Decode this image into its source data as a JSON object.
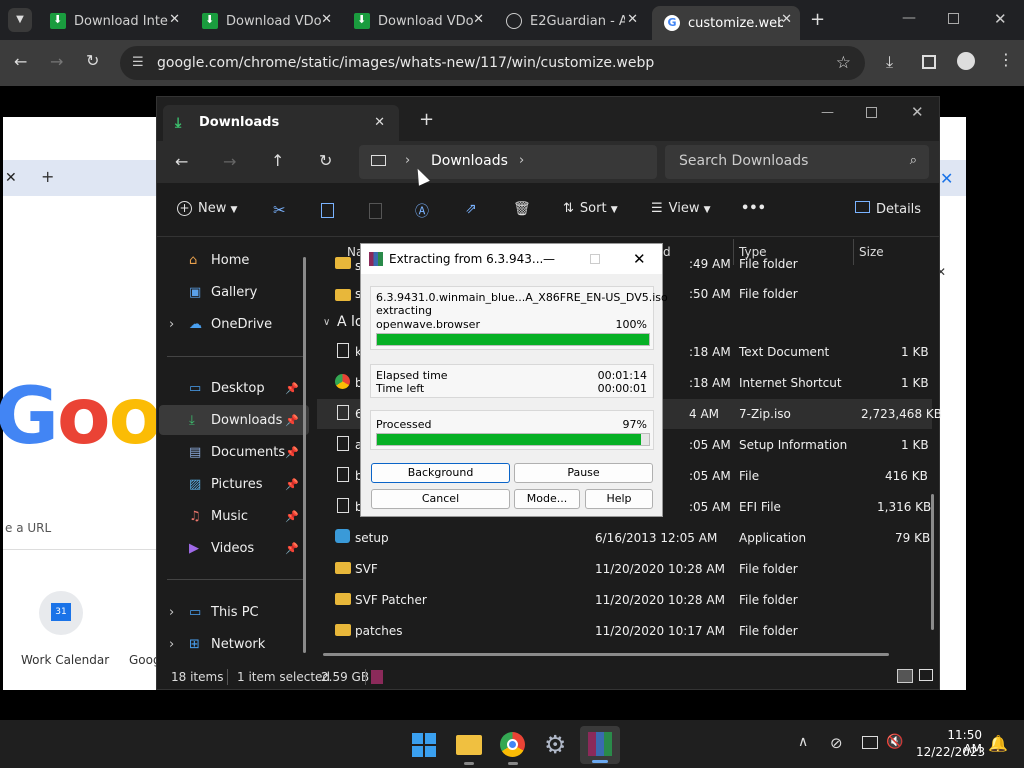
{
  "chrome": {
    "tabs": [
      {
        "title": "Download Inte"
      },
      {
        "title": "Download VDo"
      },
      {
        "title": "Download VDo"
      },
      {
        "title": "E2Guardian - A"
      },
      {
        "title": "customize.webp"
      }
    ],
    "url": "google.com/chrome/static/images/whats-new/117/win/customize.webp"
  },
  "background_page": {
    "url_hint": "e a URL",
    "shortcut": "Work Calendar",
    "shortcut2": "Goog",
    "calendar_day": "31"
  },
  "explorer": {
    "tab_title": "Downloads",
    "breadcrumb": "Downloads",
    "search_placeholder": "Search Downloads",
    "commands": {
      "new": "New",
      "sort": "Sort",
      "view": "View",
      "more": "•••",
      "details": "Details"
    },
    "sidebar": [
      {
        "label": "Home",
        "icon": "home-icon"
      },
      {
        "label": "Gallery",
        "icon": "gallery-icon"
      },
      {
        "label": "OneDrive",
        "icon": "cloud-icon"
      },
      {
        "label": "Desktop",
        "icon": "desktop-icon"
      },
      {
        "label": "Downloads",
        "icon": "download-icon"
      },
      {
        "label": "Documents",
        "icon": "documents-icon"
      },
      {
        "label": "Pictures",
        "icon": "pictures-icon"
      },
      {
        "label": "Music",
        "icon": "music-icon"
      },
      {
        "label": "Videos",
        "icon": "videos-icon"
      },
      {
        "label": "This PC",
        "icon": "pc-icon"
      },
      {
        "label": "Network",
        "icon": "network-icon"
      }
    ],
    "columns": {
      "name": "Na",
      "date": "d",
      "type": "Type",
      "size": "Size"
    },
    "group_label": "A lo",
    "rows": [
      {
        "name": "s",
        "date": ":49 AM",
        "type": "File folder",
        "size": ""
      },
      {
        "name": "s",
        "date": ":50 AM",
        "type": "File folder",
        "size": ""
      },
      {
        "name": "k",
        "date": ":18 AM",
        "type": "Text Document",
        "size": "1 KB"
      },
      {
        "name": "b",
        "date": ":18 AM",
        "type": "Internet Shortcut",
        "size": "1 KB"
      },
      {
        "name": "6",
        "date": "4 AM",
        "type": "7-Zip.iso",
        "size": "2,723,468 KB"
      },
      {
        "name": "a",
        "date": ":05 AM",
        "type": "Setup Information",
        "size": "1 KB"
      },
      {
        "name": "b",
        "date": ":05 AM",
        "type": "File",
        "size": "416 KB"
      },
      {
        "name": "b",
        "date": ":05 AM",
        "type": "EFI File",
        "size": "1,316 KB"
      },
      {
        "name": "setup",
        "date": "6/16/2013 12:05 AM",
        "type": "Application",
        "size": "79 KB"
      },
      {
        "name": "SVF",
        "date": "11/20/2020 10:28 AM",
        "type": "File folder",
        "size": ""
      },
      {
        "name": "SVF Patcher",
        "date": "11/20/2020 10:28 AM",
        "type": "File folder",
        "size": ""
      },
      {
        "name": "patches",
        "date": "11/20/2020 10:17 AM",
        "type": "File folder",
        "size": ""
      }
    ],
    "status": {
      "count": "18 items",
      "selected": "1 item selected",
      "size": "2.59 GB"
    }
  },
  "winrar": {
    "title": "Extracting from 6.3.943...",
    "archive": "6.3.9431.0.winmain_blue...A_X86FRE_EN-US_DV5.iso",
    "action": "extracting",
    "file": "openwave.browser",
    "file_percent_label": "100%",
    "file_progress": 1.0,
    "elapsed_label": "Elapsed time",
    "elapsed": "00:01:14",
    "left_label": "Time left",
    "left": "00:00:01",
    "processed_label": "Processed",
    "processed_percent_label": "97%",
    "processed_progress": 0.97,
    "buttons": {
      "background": "Background",
      "pause": "Pause",
      "cancel": "Cancel",
      "mode": "Mode...",
      "help": "Help"
    }
  },
  "taskbar": {
    "time": "11:50 AM",
    "date": "12/22/2023"
  },
  "colors": {
    "progress": "#06b025",
    "accent": "#1a73e8"
  }
}
